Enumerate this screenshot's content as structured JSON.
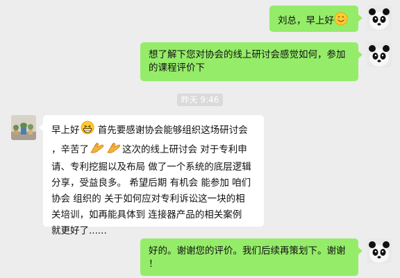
{
  "messages": [
    {
      "sender": "me",
      "text": "刘总，早上好",
      "emoji": "smile-emoji"
    },
    {
      "sender": "me",
      "lines": [
        "想了解下您对协会的线上研讨会感觉如何，参加",
        "的课程评价下"
      ]
    },
    {
      "sender": "other",
      "lines": [
        "首先要感谢协会能够组织这场研讨会",
        "，辛苦了",
        "这次的线上研讨会 对于专利申",
        "请、专利挖掘以及布局 做了一个系统的底层逻辑",
        "分享，受益良多。 希望后期 有机会 能参加 咱们",
        "协会 组织的 关于如何应对专利诉讼这一块的相",
        "关培训，如再能具体到 连接器产品的相关案例",
        "就更好了......"
      ],
      "prefix": "早上好",
      "emojis": [
        "grin-emoji",
        "clap-hands-icon",
        "clap-hands-icon"
      ]
    },
    {
      "sender": "me",
      "lines": [
        "好的。谢谢您的评价。我们后续再策划下。谢谢",
        "！"
      ]
    }
  ],
  "timestamp": "昨天 9:46",
  "colors": {
    "me_bubble": "#95ec69",
    "other_bubble": "#ffffff",
    "background": "#ededed"
  }
}
